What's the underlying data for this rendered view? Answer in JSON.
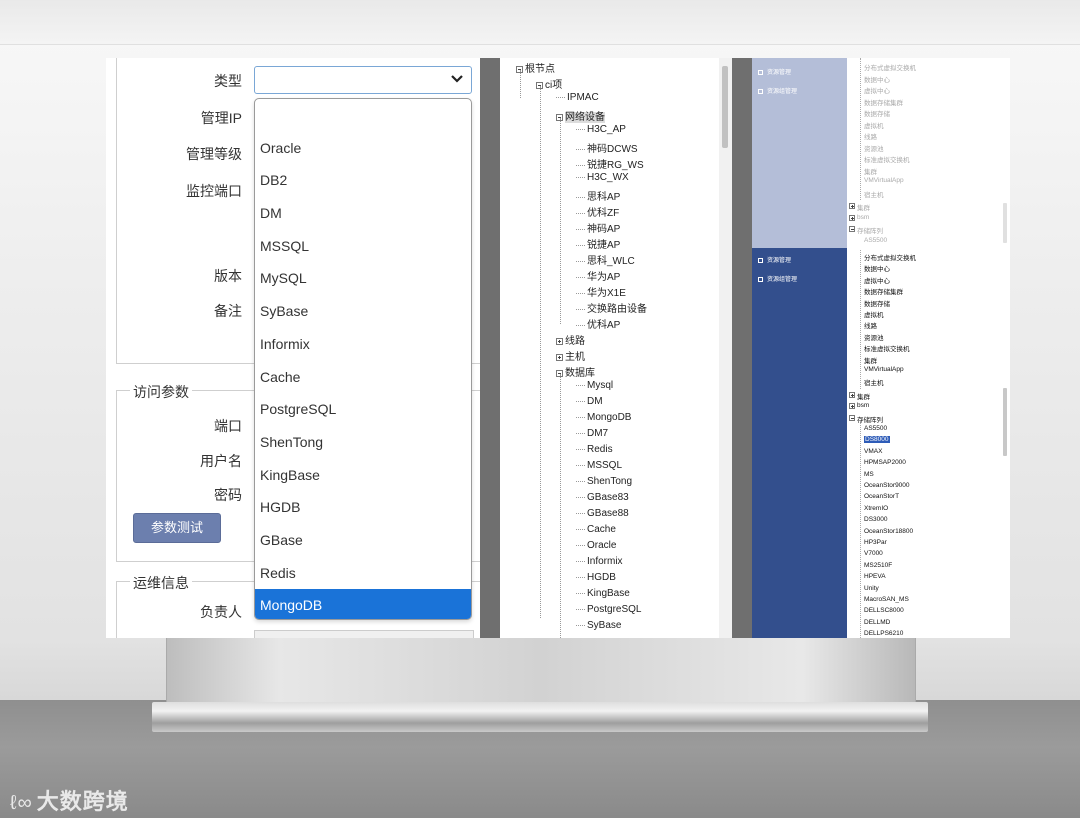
{
  "form": {
    "labels": {
      "type": "类型",
      "mgmt_ip": "管理IP",
      "mgmt_level": "管理等级",
      "monitor_port": "监控端口",
      "version": "版本",
      "remark": "备注",
      "port": "端口",
      "username": "用户名",
      "password": "密码",
      "owner": "负责人"
    },
    "sections": {
      "access_params": "访问参数",
      "ops_info": "运维信息"
    },
    "test_button": "参数测试",
    "type_select_value": "",
    "type_options": [
      "",
      "Oracle",
      "DB2",
      "DM",
      "MSSQL",
      "MySQL",
      "SyBase",
      "Informix",
      "Cache",
      "PostgreSQL",
      "ShenTong",
      "KingBase",
      "HGDB",
      "GBase",
      "Redis",
      "MongoDB"
    ],
    "selected_option": "MongoDB"
  },
  "tree": {
    "root": "根节点",
    "ci": "ci项",
    "ipmac": "IPMAC",
    "network": "网络设备",
    "network_children": [
      "H3C_AP",
      "神码DCWS",
      "锐捷RG_WS",
      "H3C_WX",
      "思科AP",
      "优科ZF",
      "神码AP",
      "锐捷AP",
      "思科_WLC",
      "华为AP",
      "华为X1E",
      "交换路由设备",
      "优科AP"
    ],
    "line": "线路",
    "host": "主机",
    "database": "数据库",
    "database_children": [
      "Mysql",
      "DM",
      "MongoDB",
      "DM7",
      "Redis",
      "MSSQL",
      "ShenTong",
      "GBase83",
      "GBase88",
      "Cache",
      "Oracle",
      "Informix",
      "HGDB",
      "KingBase",
      "PostgreSQL",
      "SyBase"
    ]
  },
  "side": {
    "nav": [
      "资源管理",
      "资源组管理"
    ],
    "faded_tree_items": [
      "分布式虚拟交换机",
      "数据中心",
      "虚拟中心",
      "数据存储集群",
      "数据存储",
      "虚拟机",
      "线路",
      "资源池",
      "标准虚拟交换机",
      "集群",
      "VMVirtualApp",
      "宿主机"
    ],
    "faded_groups": [
      "集群",
      "bsm",
      "存储阵列"
    ],
    "faded_child": "AS5500",
    "tree_items": [
      "分布式虚拟交换机",
      "数据中心",
      "虚拟中心",
      "数据存储集群",
      "数据存储",
      "虚拟机",
      "线路",
      "资源池",
      "标准虚拟交换机",
      "集群",
      "VMVirtualApp",
      "宿主机"
    ],
    "groups": [
      "集群",
      "bsm",
      "存储阵列"
    ],
    "storage_children": [
      "AS5500",
      "DS8000",
      "VMAX",
      "HPMSAP2000",
      "MS",
      "OceanStor9000",
      "OceanStorT",
      "XtremIO",
      "DS3000",
      "OceanStor18800",
      "HP3Par",
      "V7000",
      "MS2510F",
      "HPEVA",
      "Unity",
      "MacroSAN_MS",
      "DELLSC8000",
      "DELLMD",
      "DELLPS6210"
    ],
    "selected_storage": "DS8000"
  },
  "watermark": {
    "logo": "ℓ∞",
    "text": "大数跨境"
  }
}
